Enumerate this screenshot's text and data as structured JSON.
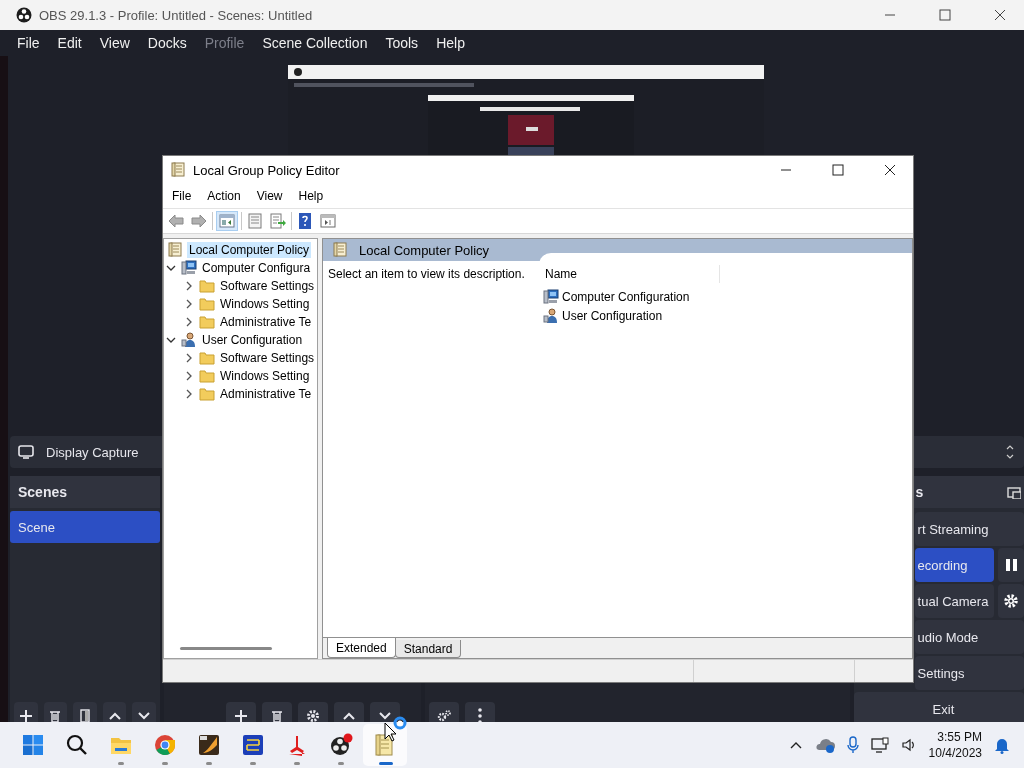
{
  "obs_window": {
    "title": "OBS 29.1.3 - Profile: Untitled - Scenes: Untitled",
    "menu": [
      {
        "label": "File",
        "disabled": false
      },
      {
        "label": "Edit",
        "disabled": false
      },
      {
        "label": "View",
        "disabled": false
      },
      {
        "label": "Docks",
        "disabled": false
      },
      {
        "label": "Profile",
        "disabled": true
      },
      {
        "label": "Scene Collection",
        "disabled": false
      },
      {
        "label": "Tools",
        "disabled": false
      },
      {
        "label": "Help",
        "disabled": false
      }
    ],
    "source_bar": {
      "source": "Display Capture"
    },
    "scenes_dock": {
      "title": "Scenes",
      "scenes": [
        {
          "name": "Scene",
          "selected": true
        }
      ]
    },
    "controls_dock": {
      "title": "s",
      "controls": [
        {
          "label": "rt Streaming",
          "kind": "plain",
          "active": false
        },
        {
          "label": "ecording",
          "kind": "pause",
          "active": true
        },
        {
          "label": "tual Camera",
          "kind": "gear",
          "active": false
        },
        {
          "label": "udio Mode",
          "kind": "plain",
          "active": false
        },
        {
          "label": "Settings",
          "kind": "plain",
          "active": false
        },
        {
          "label": "Exit",
          "kind": "plain",
          "active": false
        }
      ]
    }
  },
  "gpe_window": {
    "title": "Local Group Policy Editor",
    "menu": [
      "File",
      "Action",
      "View",
      "Help"
    ],
    "tree": [
      {
        "label": "Local Computer Policy",
        "kind": "policy",
        "selected": true,
        "children": [
          {
            "label": "Computer Configura",
            "kind": "computer",
            "expanded": true,
            "selected": false,
            "children": [
              {
                "label": "Software Settings",
                "kind": "folder",
                "expanded": false,
                "selected": false
              },
              {
                "label": "Windows Setting",
                "kind": "folder",
                "expanded": false,
                "selected": false
              },
              {
                "label": "Administrative Te",
                "kind": "folder",
                "expanded": false,
                "selected": false
              }
            ]
          },
          {
            "label": "User Configuration",
            "kind": "user",
            "expanded": true,
            "selected": false,
            "children": [
              {
                "label": "Software Settings",
                "kind": "folder",
                "expanded": false,
                "selected": false
              },
              {
                "label": "Windows Setting",
                "kind": "folder",
                "expanded": false,
                "selected": false
              },
              {
                "label": "Administrative Te",
                "kind": "folder",
                "expanded": false,
                "selected": false
              }
            ]
          }
        ]
      }
    ],
    "detail": {
      "title": "Local Computer Policy",
      "description": "Select an item to view its description.",
      "column": "Name",
      "items": [
        {
          "label": "Computer Configuration",
          "kind": "computer"
        },
        {
          "label": "User Configuration",
          "kind": "user"
        }
      ]
    },
    "tabs": [
      {
        "label": "Extended",
        "selected": true
      },
      {
        "label": "Standard",
        "selected": false
      }
    ]
  },
  "taskbar": {
    "apps": [
      {
        "kind": "start",
        "running": false,
        "active": false
      },
      {
        "kind": "search",
        "running": false,
        "active": false
      },
      {
        "kind": "explorer",
        "running": true,
        "active": false
      },
      {
        "kind": "chrome",
        "running": true,
        "active": false
      },
      {
        "kind": "c4",
        "running": true,
        "active": false
      },
      {
        "kind": "blueapp",
        "running": true,
        "active": false
      },
      {
        "kind": "redapp",
        "running": true,
        "active": false
      },
      {
        "kind": "obs",
        "running": true,
        "active": false
      },
      {
        "kind": "notepad",
        "running": true,
        "active": true
      }
    ],
    "time": "3:55 PM",
    "date": "10/4/2023"
  }
}
